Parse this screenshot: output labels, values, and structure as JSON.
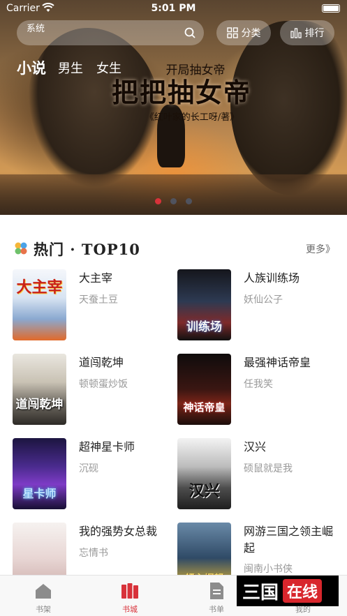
{
  "status_bar": {
    "carrier": "Carrier",
    "time": "5:01 PM"
  },
  "header": {
    "search_placeholder": "系统",
    "category_label": "分类",
    "rank_label": "排行",
    "tabs": [
      "小说",
      "男生",
      "女生"
    ]
  },
  "banner": {
    "small_title": "开局抽女帝",
    "big_title": "把把抽女帝",
    "byline": "《红叶家的长工呀/著》",
    "slide_count": 3,
    "active_slide": 1
  },
  "hot_section": {
    "title": "热门 · TOP10",
    "more_label": "更多》",
    "books": [
      {
        "name": "大主宰",
        "author": "天蚕土豆",
        "cover_text": "大主宰"
      },
      {
        "name": "人族训练场",
        "author": "妖仙公子",
        "cover_text": "训练场"
      },
      {
        "name": "道闯乾坤",
        "author": "顿顿蛋炒饭",
        "cover_text": "道闯乾坤"
      },
      {
        "name": "最强神话帝皇",
        "author": "任我笑",
        "cover_text": "神话帝皇"
      },
      {
        "name": "超神星卡师",
        "author": "沉砚",
        "cover_text": "星卡师"
      },
      {
        "name": "汉兴",
        "author": "硕鼠就是我",
        "cover_text": "汉兴"
      },
      {
        "name": "我的强势女总裁",
        "author": "忘情书",
        "cover_text": ""
      },
      {
        "name": "网游三国之领主崛起",
        "author": "闽南小书侠",
        "cover_text": "领主崛起"
      }
    ]
  },
  "tab_bar": {
    "items": [
      "书架",
      "书城",
      "书单",
      "我的"
    ],
    "active_index": 1
  },
  "watermark": {
    "part_a": "三国",
    "part_b": "在线"
  },
  "colors": {
    "accent": "#d8323a",
    "muted_text": "#999999",
    "tab_inactive": "#888888"
  }
}
